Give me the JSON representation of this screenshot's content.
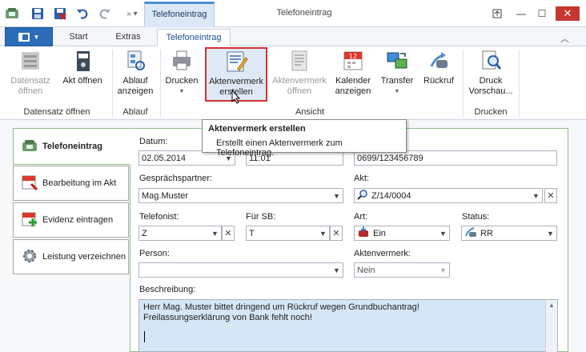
{
  "window": {
    "title": "Telefoneintrag",
    "context_tab": "Telefoneintrag"
  },
  "tabs": {
    "start": "Start",
    "extras": "Extras",
    "telefoneintrag": "Telefoneintrag"
  },
  "ribbon": {
    "datensatz_oeffnen": "Datensatz öffnen",
    "akt_oeffnen": "Akt öffnen",
    "ablauf_anzeigen": "Ablauf anzeigen",
    "drucken": "Drucken",
    "aktenvermerk_erstellen": "Aktenvermerk erstellen",
    "aktenvermerk_oeffnen": "Aktenvermerk öffnen",
    "kalender_anzeigen": "Kalender anzeigen",
    "transfer": "Transfer",
    "rueckruf": "Rückruf",
    "druck_vorschau": "Druck Vorschau...",
    "groups": {
      "datensatz": "Datensatz öffnen",
      "ablauf": "Ablauf",
      "ansicht": "Ansicht",
      "drucken": "Drucken"
    }
  },
  "tooltip": {
    "title": "Aktenvermerk erstellen",
    "description": "Erstellt einen Aktenvermerk zum Telefoneintrag."
  },
  "sidebar": {
    "items": [
      {
        "label": "Telefoneintrag"
      },
      {
        "label": "Bearbeitung im Akt"
      },
      {
        "label": "Evidenz eintragen"
      },
      {
        "label": "Leistung verzeichnen"
      }
    ]
  },
  "form": {
    "datum_label": "Datum:",
    "datum_value": "02.05.2014",
    "zeit_value": "11:01",
    "telefon_value": "0699/123456789",
    "gespraechspartner_label": "Gesprächspartner:",
    "gespraechspartner_value": "Mag.Muster",
    "akt_label": "Akt:",
    "akt_value": "Z/14/0004",
    "telefonist_label": "Telefonist:",
    "telefonist_value": "Z",
    "fuer_sb_label": "Für SB:",
    "fuer_sb_value": "T",
    "art_label": "Art:",
    "art_value": "Ein",
    "status_label": "Status:",
    "status_value": "RR",
    "person_label": "Person:",
    "person_value": "",
    "aktenvermerk_label": "Aktenvermerk:",
    "aktenvermerk_value": "Nein",
    "beschreibung_label": "Beschreibung:",
    "beschreibung_value": "Herr Mag. Muster bittet dringend um Rückruf wegen Grundbuchantrag!\nFreilassungserklärung von Bank fehlt noch!"
  },
  "colors": {
    "accent": "#2b6cb8",
    "highlight_border": "#d43030",
    "panel_border": "#8fc08f",
    "description_bg": "#d5e6f6"
  }
}
